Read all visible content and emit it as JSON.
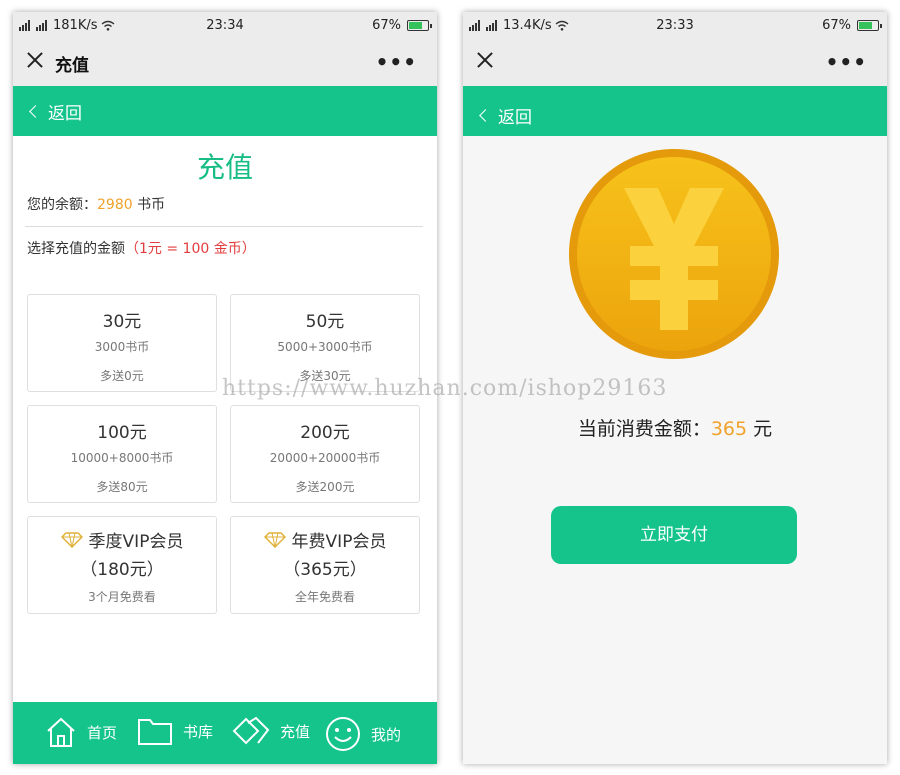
{
  "left": {
    "status": {
      "speed": "181K/s",
      "time": "23:34",
      "battery": "67%"
    },
    "titlebar": {
      "title": "充值"
    },
    "nav": {
      "back_label": "返回"
    },
    "page_title": "充值",
    "balance": {
      "prefix": "您的余额：",
      "amount": "2980",
      "unit": " 书币"
    },
    "choose": {
      "label": "选择充值的金额",
      "rate": "（1元 = 100 金币）"
    },
    "packages": [
      {
        "price": "30元",
        "coins": "3000书币",
        "bonus": "多送0元"
      },
      {
        "price": "50元",
        "coins": "5000+3000书币",
        "bonus": "多送30元"
      },
      {
        "price": "100元",
        "coins": "10000+8000书币",
        "bonus": "多送80元"
      },
      {
        "price": "200元",
        "coins": "20000+20000书币",
        "bonus": "多送200元"
      }
    ],
    "vip": [
      {
        "name": "季度VIP会员",
        "price": "（180元）",
        "note": "3个月免费看"
      },
      {
        "name": "年费VIP会员",
        "price": "（365元）",
        "note": "全年免费看"
      }
    ],
    "tabs": [
      {
        "label": "首页",
        "icon": "home-icon"
      },
      {
        "label": "书库",
        "icon": "folder-icon"
      },
      {
        "label": "充值",
        "icon": "diamond-icon"
      },
      {
        "label": "我的",
        "icon": "smiley-icon"
      }
    ]
  },
  "right": {
    "status": {
      "speed": "13.4K/s",
      "time": "23:33",
      "battery": "67%"
    },
    "nav": {
      "back_label": "返回"
    },
    "coin_symbol": "¥",
    "amount": {
      "prefix": "当前消费金额：",
      "value": "365",
      "unit": " 元"
    },
    "pay_button": "立即支付"
  },
  "watermark": "https://www.huzhan.com/ishop29163",
  "colors": {
    "brand_green": "#14c48a",
    "accent_orange": "#f0a22b",
    "rate_red": "#e23d3d"
  }
}
